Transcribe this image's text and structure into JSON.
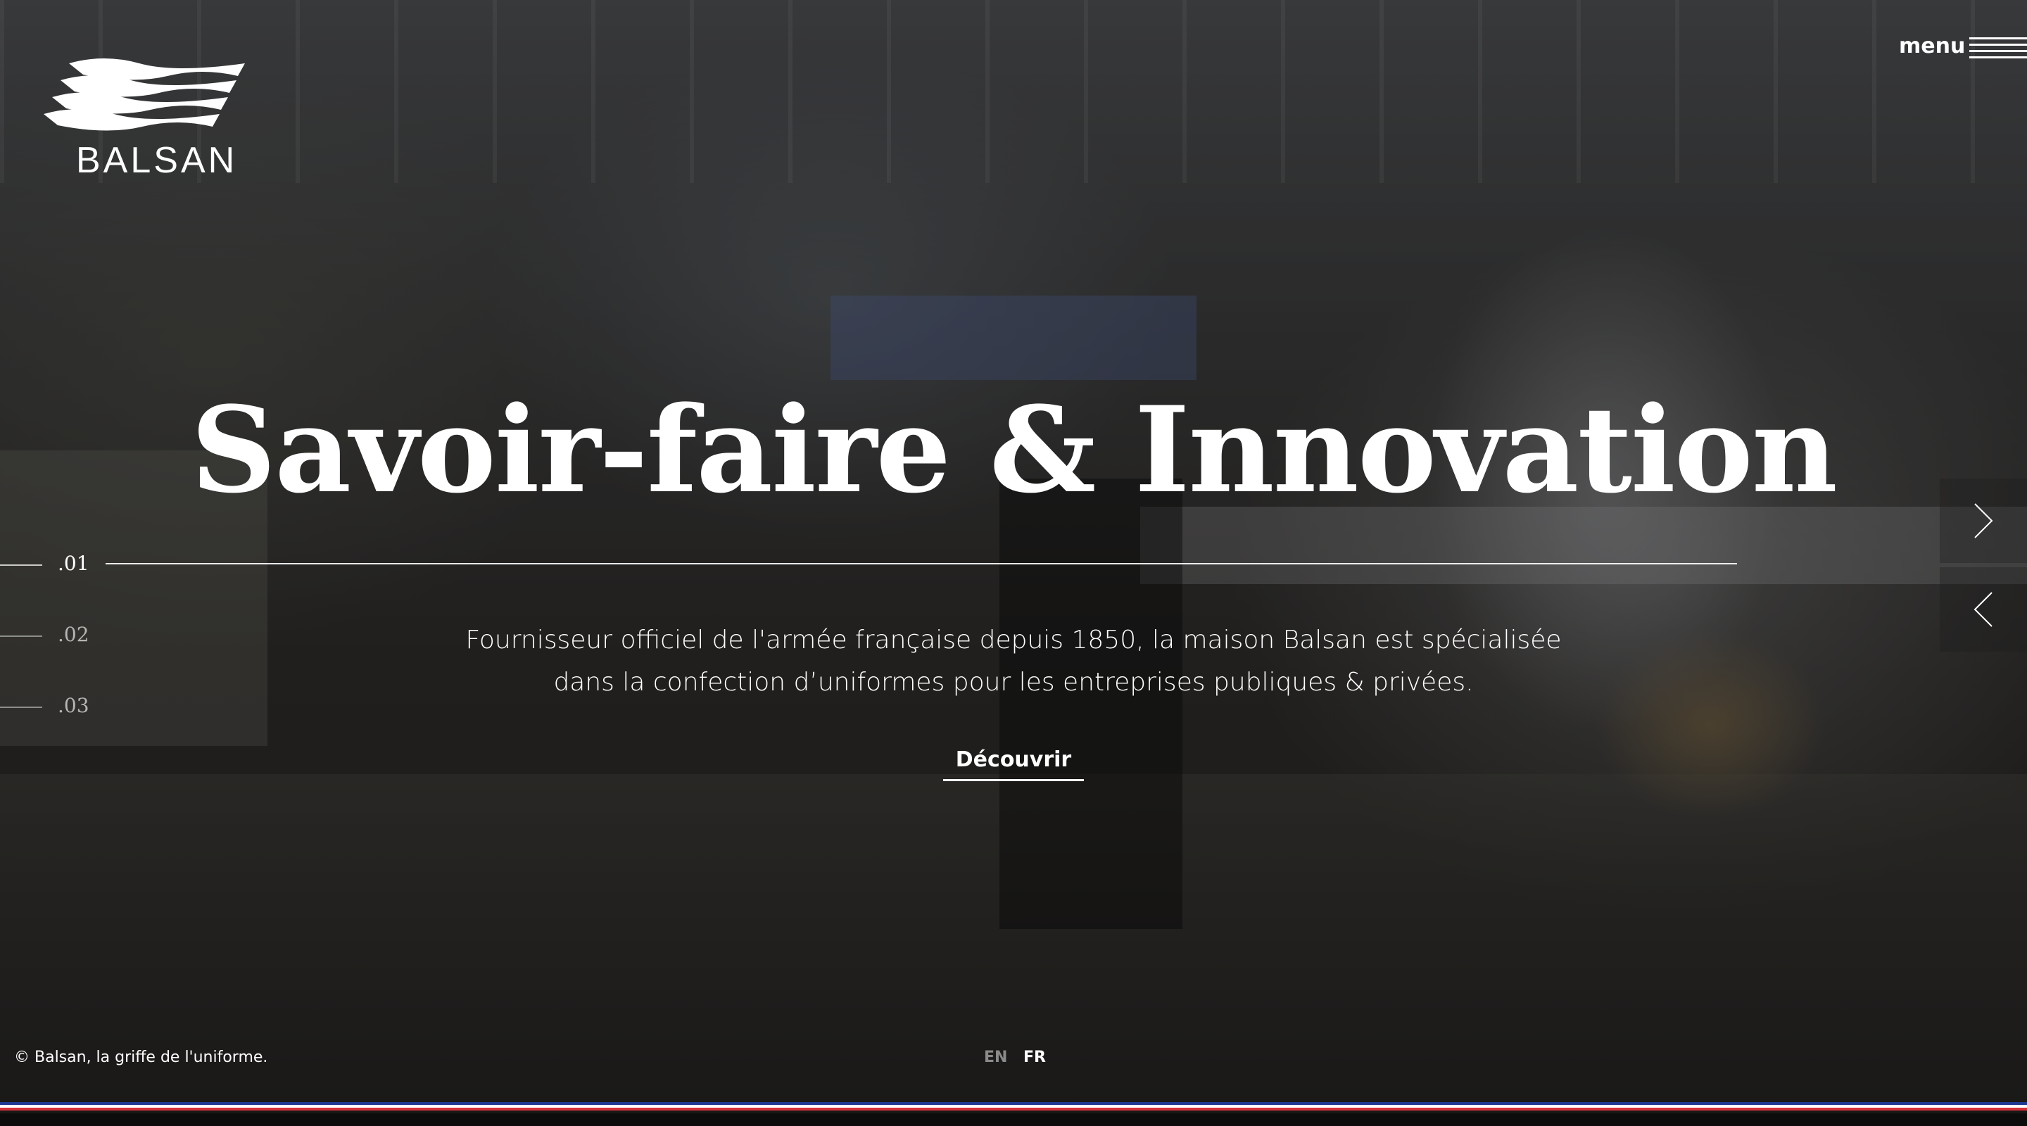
{
  "brand": {
    "logo_text": "BALSAN",
    "logo_icon": "wave-flag-icon"
  },
  "header": {
    "menu_label": "menu",
    "menu_icon": "hamburger-icon"
  },
  "hero": {
    "headline": "Savoir-faire & Innovation",
    "description_line1": "Fournisseur officiel de l'armée française depuis 1850, la maison Balsan est spécialisée",
    "description_line2": "dans la confection d’uniformes pour les entreprises publiques & privées.",
    "cta_label": "Découvrir"
  },
  "slides": {
    "items": [
      {
        "label": ".01",
        "active": true
      },
      {
        "label": ".02",
        "active": false
      },
      {
        "label": ".03",
        "active": false
      }
    ],
    "next_icon": "chevron-right-icon",
    "prev_icon": "chevron-left-icon"
  },
  "footer": {
    "copyright": "© Balsan, la griffe de l'uniforme.",
    "languages": [
      {
        "code": "EN",
        "active": false
      },
      {
        "code": "FR",
        "active": true
      }
    ],
    "stripe_colors": [
      "#1f3a93",
      "#ffffff",
      "#d6323a"
    ]
  },
  "colors": {
    "text_primary": "#ffffff",
    "text_muted": "#8a8a8a",
    "index_inactive": "#b5b5b5"
  }
}
